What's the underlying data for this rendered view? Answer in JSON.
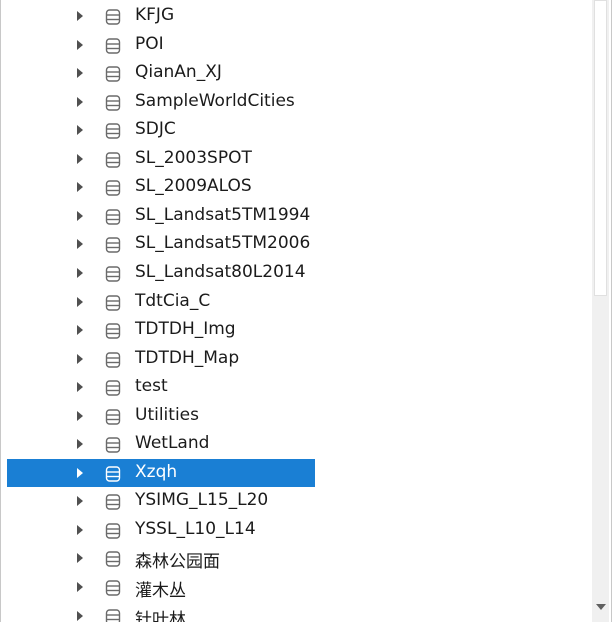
{
  "tree": {
    "items": [
      {
        "label": "KFJG",
        "selected": false
      },
      {
        "label": "POI",
        "selected": false
      },
      {
        "label": "QianAn_XJ",
        "selected": false
      },
      {
        "label": "SampleWorldCities",
        "selected": false
      },
      {
        "label": "SDJC",
        "selected": false
      },
      {
        "label": "SL_2003SPOT",
        "selected": false
      },
      {
        "label": "SL_2009ALOS",
        "selected": false
      },
      {
        "label": "SL_Landsat5TM1994",
        "selected": false
      },
      {
        "label": "SL_Landsat5TM2006",
        "selected": false
      },
      {
        "label": "SL_Landsat80L2014",
        "selected": false
      },
      {
        "label": "TdtCia_C",
        "selected": false
      },
      {
        "label": "TDTDH_Img",
        "selected": false
      },
      {
        "label": "TDTDH_Map",
        "selected": false
      },
      {
        "label": "test",
        "selected": false
      },
      {
        "label": "Utilities",
        "selected": false
      },
      {
        "label": "WetLand",
        "selected": false
      },
      {
        "label": "Xzqh",
        "selected": true
      },
      {
        "label": "YSIMG_L15_L20",
        "selected": false
      },
      {
        "label": "YSSL_L10_L14",
        "selected": false
      },
      {
        "label": "森林公园面",
        "selected": false
      },
      {
        "label": "灌木丛",
        "selected": false
      },
      {
        "label": "针叶林",
        "selected": false
      }
    ],
    "expand_icon": "chevron-right-icon",
    "item_icon": "database-icon"
  },
  "colors": {
    "selection": "#1a7fd4",
    "text": "#1b1b1b",
    "icon": "#6a6a6a"
  }
}
